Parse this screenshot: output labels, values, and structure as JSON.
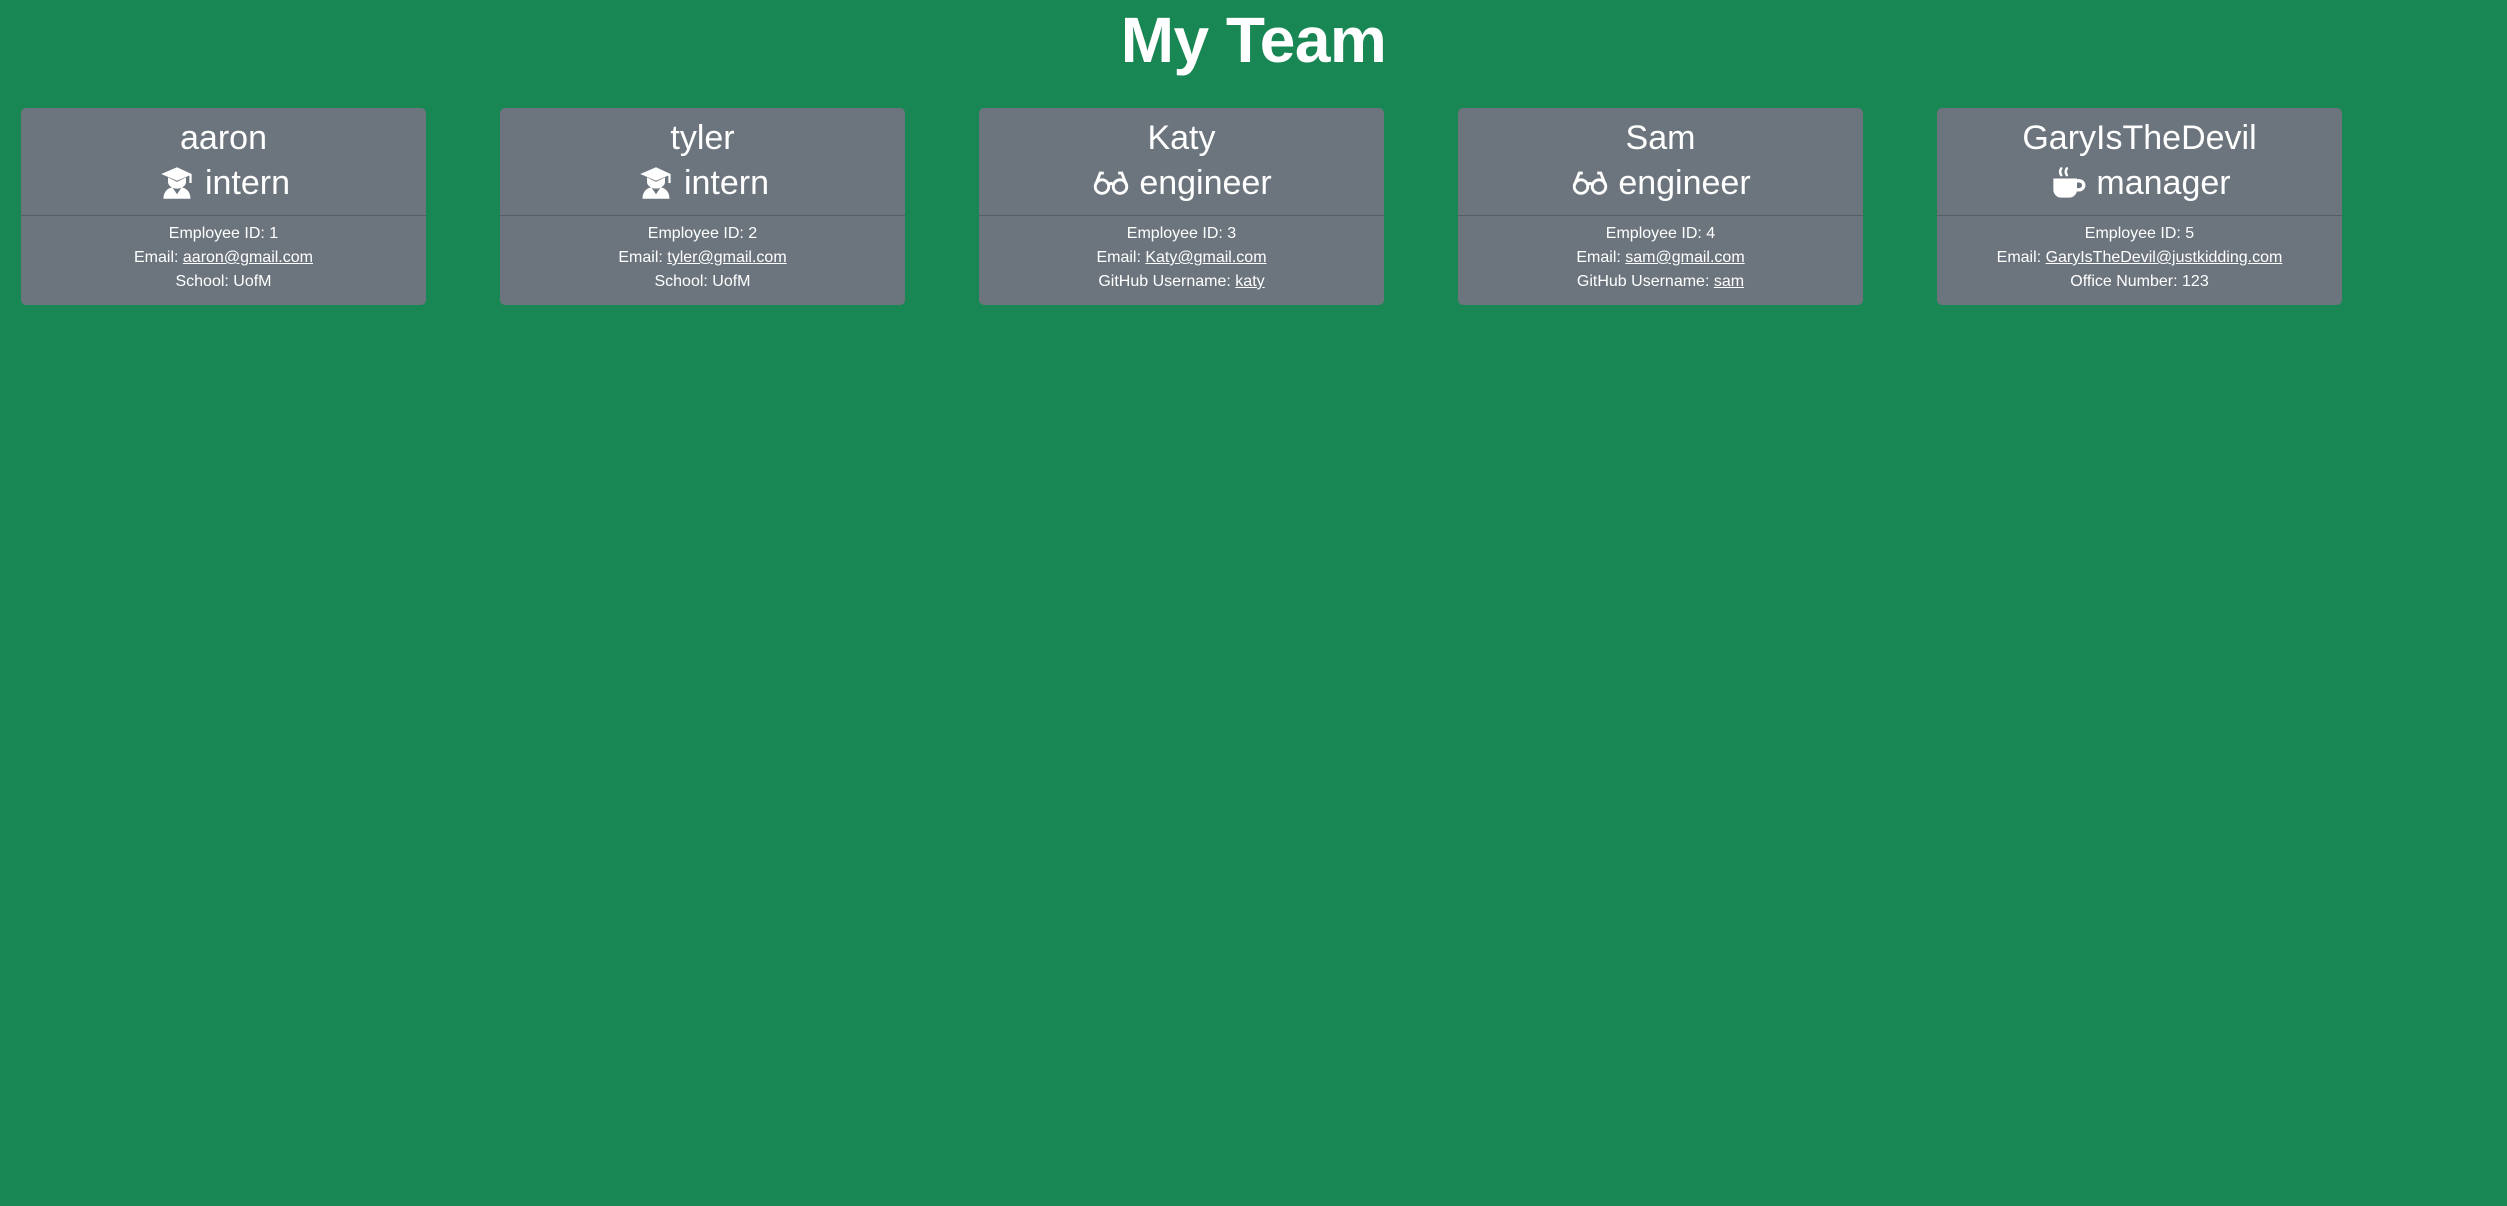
{
  "page": {
    "title": "My Team"
  },
  "colors": {
    "background": "#198754",
    "card": "#6c757d",
    "text": "#ffffff"
  },
  "team": [
    {
      "name": "aaron",
      "role": "intern",
      "role_icon": "graduate-icon",
      "id_label": "Employee ID: 1",
      "email_prefix": "Email: ",
      "email": "aaron@gmail.com",
      "extra_prefix": "School: ",
      "extra_value": "UofM"
    },
    {
      "name": "tyler",
      "role": "intern",
      "role_icon": "graduate-icon",
      "id_label": "Employee ID: 2",
      "email_prefix": "Email: ",
      "email": "tyler@gmail.com",
      "extra_prefix": "School: ",
      "extra_value": "UofM"
    },
    {
      "name": "Katy",
      "role": "engineer",
      "role_icon": "glasses-icon",
      "id_label": "Employee ID: 3",
      "email_prefix": "Email: ",
      "email": "Katy@gmail.com",
      "extra_prefix": "GitHub Username: ",
      "extra_value": "katy"
    },
    {
      "name": "Sam",
      "role": "engineer",
      "role_icon": "glasses-icon",
      "id_label": "Employee ID: 4",
      "email_prefix": "Email: ",
      "email": "sam@gmail.com",
      "extra_prefix": "GitHub Username: ",
      "extra_value": "sam"
    },
    {
      "name": "GaryIsTheDevil",
      "role": "manager",
      "role_icon": "coffee-icon",
      "id_label": "Employee ID: 5",
      "email_prefix": "Email: ",
      "email": "GaryIsTheDevil@justkidding.com",
      "extra_prefix": "Office Number: ",
      "extra_value": "123"
    }
  ]
}
